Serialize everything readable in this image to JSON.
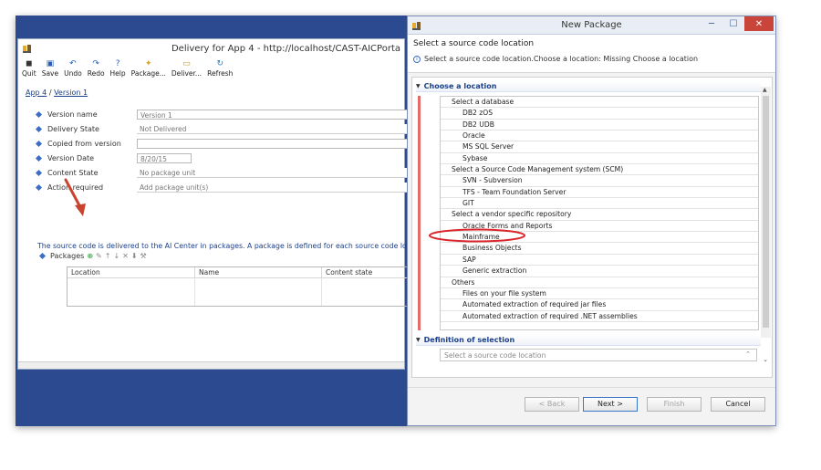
{
  "delivery_window": {
    "title": "Delivery for App 4 - http://localhost/CAST-AICPorta",
    "toolbar": [
      {
        "label": "Quit",
        "icon": "quit-icon",
        "glyph": "◼"
      },
      {
        "label": "Save",
        "icon": "save-icon",
        "glyph": "▣"
      },
      {
        "label": "Undo",
        "icon": "undo-icon",
        "glyph": "↶"
      },
      {
        "label": "Redo",
        "icon": "redo-icon",
        "glyph": "↷"
      },
      {
        "label": "Help",
        "icon": "help-icon",
        "glyph": "?"
      },
      {
        "label": "Package...",
        "icon": "package-icon",
        "glyph": "✦"
      },
      {
        "label": "Deliver...",
        "icon": "deliver-icon",
        "glyph": "▭"
      },
      {
        "label": "Refresh",
        "icon": "refresh-icon",
        "glyph": "↻"
      }
    ],
    "breadcrumb": {
      "app": "App 4",
      "separator": "/",
      "version": "Version 1"
    },
    "fields": [
      {
        "label": "Version name",
        "value": "Version 1"
      },
      {
        "label": "Delivery State",
        "value": "Not Delivered"
      },
      {
        "label": "Copied from version",
        "value": ""
      },
      {
        "label": "Version Date",
        "value": "8/20/15"
      },
      {
        "label": "Content State",
        "value": "No package unit"
      },
      {
        "label": "Action required",
        "value": "Add package unit(s)"
      }
    ],
    "info_text": "The source code is delivered to the AI Center in packages. A package is defined for each source code location.",
    "packages_label": "Packages",
    "table_headers": [
      "Location",
      "Name",
      "Content state"
    ]
  },
  "new_package_window": {
    "title": "New Package",
    "window_buttons": {
      "minimize": "─",
      "maximize": "☐",
      "close": "✕"
    },
    "header_title": "Select a source code location",
    "header_message": "Select a source code location.Choose a location: Missing Choose a location",
    "section_choose": "Choose a location",
    "tree": [
      {
        "type": "group",
        "label": "Select a database"
      },
      {
        "type": "item",
        "label": "DB2 zOS"
      },
      {
        "type": "item",
        "label": "DB2 UDB"
      },
      {
        "type": "item",
        "label": "Oracle"
      },
      {
        "type": "item",
        "label": "MS SQL Server"
      },
      {
        "type": "item",
        "label": "Sybase"
      },
      {
        "type": "group",
        "label": "Select a Source Code Management system (SCM)"
      },
      {
        "type": "item",
        "label": "SVN - Subversion"
      },
      {
        "type": "item",
        "label": "TFS - Team Foundation Server"
      },
      {
        "type": "item",
        "label": "GIT"
      },
      {
        "type": "group",
        "label": "Select a vendor specific repository"
      },
      {
        "type": "item",
        "label": "Oracle Forms and Reports"
      },
      {
        "type": "item",
        "label": "Mainframe"
      },
      {
        "type": "item",
        "label": "Business Objects"
      },
      {
        "type": "item",
        "label": "SAP"
      },
      {
        "type": "item",
        "label": "Generic extraction"
      },
      {
        "type": "group",
        "label": "Others"
      },
      {
        "type": "item",
        "label": "Files on your file system"
      },
      {
        "type": "item",
        "label": "Automated extraction of required jar files"
      },
      {
        "type": "item",
        "label": "Automated extraction of required .NET assemblies"
      }
    ],
    "section_definition": "Definition of selection",
    "definition_placeholder": "Select a source code location",
    "buttons": {
      "back": "< Back",
      "next": "Next >",
      "finish": "Finish",
      "cancel": "Cancel"
    }
  },
  "colors": {
    "desktop": "#2b4a8f",
    "link": "#1b3f8a",
    "highlight_ellipse": "#d9262c",
    "arrow": "#c8442f",
    "close": "#c9453a"
  }
}
